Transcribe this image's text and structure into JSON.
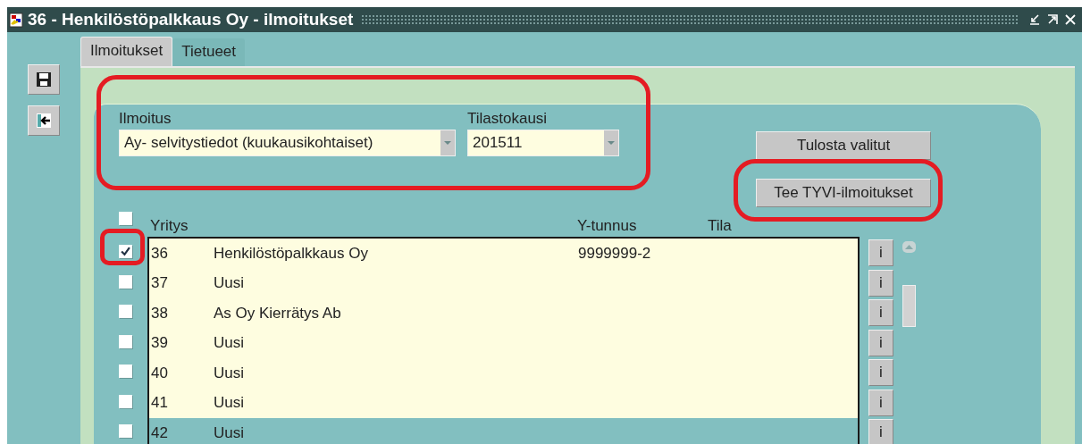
{
  "window": {
    "title": "36 - Henkilöstöpalkkaus Oy - ilmoitukset"
  },
  "tabs": [
    {
      "label": "Ilmoitukset",
      "selected": true
    },
    {
      "label": "Tietueet",
      "selected": false
    }
  ],
  "fields": [
    {
      "label": "Ilmoitus",
      "value": "Ay- selvitystiedot (kuukausikohtaiset)"
    },
    {
      "label": "Tilastokausi",
      "value": "201511"
    }
  ],
  "buttons": [
    "Tulosta valitut",
    "Tee TYVI-ilmoitukset"
  ],
  "table": {
    "select_all": {
      "checked": false
    },
    "columns": [
      "Yritys",
      "Y-tunnus",
      "Tila"
    ],
    "rows": [
      {
        "number": "36",
        "name": "Henkilöstöpalkkaus Oy",
        "y_tunnus": "9999999-2",
        "checked": true,
        "selected": false,
        "info": "i"
      },
      {
        "number": "37",
        "name": "Uusi",
        "checked": false,
        "selected": false,
        "info": "i"
      },
      {
        "number": "38",
        "name": "As Oy Kierrätys Ab",
        "checked": false,
        "selected": false,
        "info": "i"
      },
      {
        "number": "39",
        "name": "Uusi",
        "checked": false,
        "selected": false,
        "info": "i"
      },
      {
        "number": "40",
        "name": "Uusi",
        "checked": false,
        "selected": false,
        "info": "i"
      },
      {
        "number": "41",
        "name": "Uusi",
        "checked": false,
        "selected": false,
        "info": "i"
      },
      {
        "number": "42",
        "name": "Uusi",
        "checked": false,
        "selected": true,
        "info": "i"
      }
    ]
  }
}
